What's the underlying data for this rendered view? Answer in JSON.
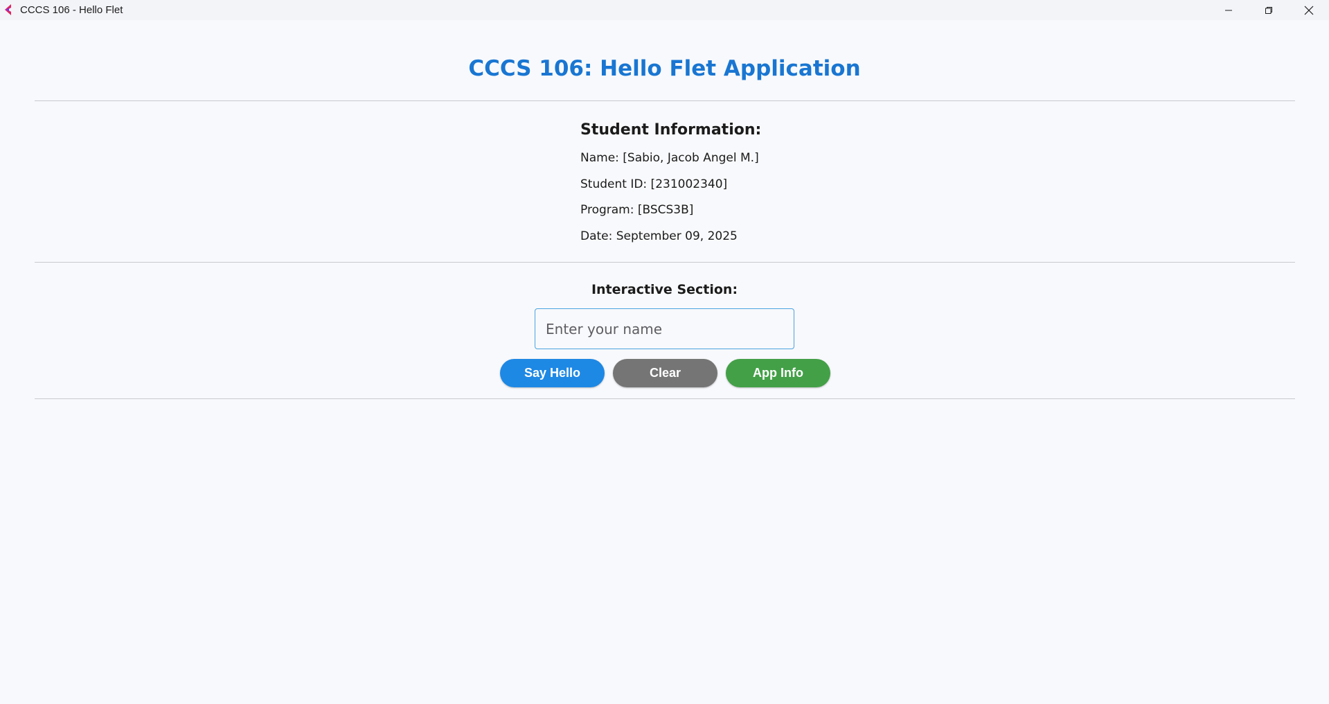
{
  "window": {
    "title": "CCCS 106 - Hello Flet"
  },
  "header": {
    "title": "CCCS 106: Hello Flet Application"
  },
  "student_info": {
    "heading": "Student Information:",
    "name": "Name: [Sabio, Jacob Angel M.]",
    "student_id": "Student ID: [231002340]",
    "program": "Program: [BSCS3B]",
    "date": "Date: September 09, 2025"
  },
  "interactive": {
    "heading": "Interactive Section:",
    "input_placeholder": "Enter your name",
    "input_value": "",
    "buttons": {
      "say_hello": "Say Hello",
      "clear": "Clear",
      "app_info": "App Info"
    }
  },
  "colors": {
    "accent": "#1976d2",
    "say_hello": "#1e88e5",
    "clear": "#757575",
    "app_info": "#43a047",
    "input_border": "#4aa3df",
    "background": "#f8f9fc"
  },
  "icons": {
    "app": "flet-logo-icon",
    "minimize": "minimize-icon",
    "maximize": "restore-icon",
    "close": "close-icon"
  }
}
